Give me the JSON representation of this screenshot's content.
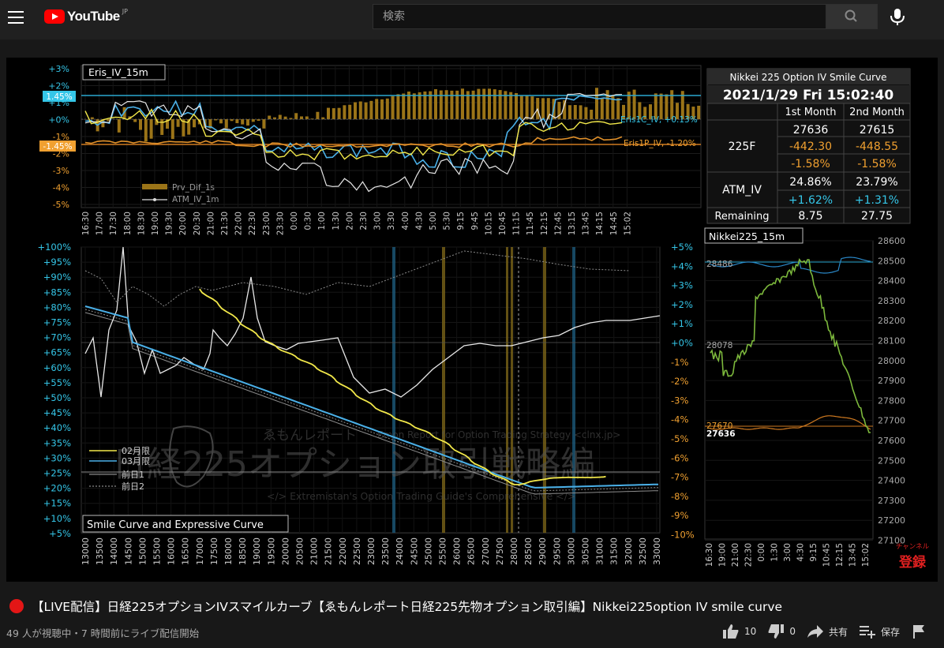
{
  "header": {
    "logo_text": "YouTube",
    "region": "JP",
    "search_placeholder": "検索"
  },
  "video": {
    "iv_panel": {
      "title": "Eris_IV_15m",
      "y_ticks": [
        "+3%",
        "+2%",
        "+1%",
        "+0%",
        "-1%",
        "-2%",
        "-3%",
        "-4%",
        "-5%"
      ],
      "upper_badge": "1.45%",
      "lower_badge": "-1.45%",
      "call_label": "Eris1C_IV, +0.13%",
      "put_label": "Eris1P_IV, -1.20%",
      "legend_bar": "Prv_Dif_1s",
      "legend_line": "ATM_IV_1m",
      "x_ticks": [
        "16:30",
        "17:00",
        "17:30",
        "18:00",
        "18:30",
        "19:00",
        "19:30",
        "20:00",
        "20:30",
        "21:00",
        "21:30",
        "22:00",
        "22:30",
        "23:00",
        "23:30",
        "0:00",
        "0:30",
        "1:00",
        "1:30",
        "2:00",
        "2:30",
        "3:00",
        "3:30",
        "4:00",
        "4:30",
        "5:00",
        "5:30",
        "9:15",
        "9:45",
        "10:15",
        "10:45",
        "11:15",
        "11:45",
        "12:15",
        "12:45",
        "13:15",
        "13:45",
        "14:15",
        "14:45",
        "15:02"
      ]
    },
    "info_table": {
      "title": "Nikkei 225 Option IV Smile Curve",
      "datetime": "2021/1/29 Fri 15:02:40",
      "col1": "1st Month",
      "col2": "2nd Month",
      "row_225f": "225F",
      "f_price_1": "27636",
      "f_price_2": "27615",
      "f_chg_1": "-442.30",
      "f_chg_2": "-448.55",
      "f_pct_1": "-1.58%",
      "f_pct_2": "-1.58%",
      "row_atm": "ATM_IV",
      "atm_1": "24.86%",
      "atm_2": "23.79%",
      "atm_chg_1": "+1.62%",
      "atm_chg_2": "+1.31%",
      "row_remaining": "Remaining",
      "rem_1": "8.75",
      "rem_2": "27.75"
    },
    "smile_panel": {
      "title": "Smile Curve and Expressive Curve",
      "left_ticks": [
        "+100%",
        "+95%",
        "+90%",
        "+85%",
        "+80%",
        "+75%",
        "+70%",
        "+65%",
        "+60%",
        "+55%",
        "+50%",
        "+45%",
        "+40%",
        "+35%",
        "+30%",
        "+25%",
        "+20%",
        "+15%",
        "+10%",
        "+5%"
      ],
      "right_ticks": [
        "+5%",
        "+4%",
        "+3%",
        "+2%",
        "+1%",
        "+0%",
        "-1%",
        "-2%",
        "-3%",
        "-4%",
        "-5%",
        "-6%",
        "-7%",
        "-8%",
        "-9%",
        "-10%"
      ],
      "x_ticks": [
        "13000",
        "13500",
        "14000",
        "14500",
        "15000",
        "15500",
        "16000",
        "16500",
        "17000",
        "17500",
        "18000",
        "18500",
        "19000",
        "19500",
        "20000",
        "20500",
        "21000",
        "21500",
        "22000",
        "22500",
        "23000",
        "23500",
        "24000",
        "24500",
        "25000",
        "25500",
        "26000",
        "26500",
        "27000",
        "27500",
        "28000",
        "28500",
        "29000",
        "29500",
        "30000",
        "30500",
        "31000",
        "31500",
        "32000",
        "32500",
        "33000"
      ],
      "legend": [
        "02月限",
        "03月限",
        "前日1",
        "前日2"
      ],
      "watermark_main": "日経225オプション取引戦略編",
      "watermark_top": "ゑもんレポート",
      "watermark_top_en": "Emon Report for Option Trading Strategy <clnx.jp>",
      "watermark_bottom": "</> Extremistan's Option Trading Guide's Comprehensive </>"
    },
    "nikkei_panel": {
      "title": "Nikkei225_15m",
      "y_ticks": [
        "28600",
        "28500",
        "28400",
        "28300",
        "28200",
        "28100",
        "28000",
        "27900",
        "27800",
        "27700",
        "27600",
        "27500",
        "27400",
        "27300",
        "27200",
        "27100"
      ],
      "label_high": "28486",
      "label_mid": "28078",
      "label_low": "27670",
      "label_last": "27636",
      "x_ticks": [
        "16:30",
        "19:00",
        "21:00",
        "22:30",
        "0:00",
        "1:30",
        "3:00",
        "4:30",
        "9:15",
        "10:45",
        "12:15",
        "13:45",
        "15:02"
      ]
    },
    "subscribe": {
      "small": "チャンネル",
      "big": "登録"
    }
  },
  "title": "【LIVE配信】日経225オプションIVスマイルカーブ【ゑもんレポート日経225先物オプション取引編】Nikkei225option IV smile curve",
  "meta": "49 人が視聴中・7 時間前にライブ配信開始",
  "actions": {
    "like_count": "10",
    "dislike_count": "0",
    "share": "共有",
    "save": "保存"
  },
  "colors": {
    "cyan": "#35c6e8",
    "orange": "#f0a030",
    "yellow": "#f2e84a",
    "blue_line": "#4ab0e8",
    "bar": "#9b7418"
  }
}
